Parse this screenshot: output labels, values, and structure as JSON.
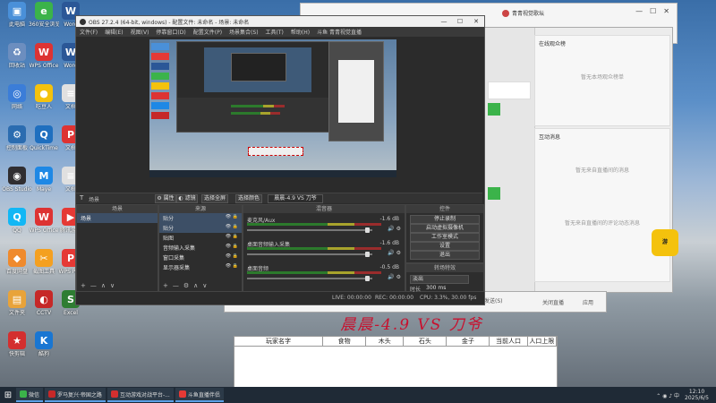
{
  "desktop": {
    "icons": [
      {
        "label": "此电脑",
        "color": "#4a90d9",
        "glyph": "▣"
      },
      {
        "label": "360安全浏览器",
        "color": "#3bb34a",
        "glyph": "e"
      },
      {
        "label": "Word",
        "color": "#2b5797",
        "glyph": "W"
      },
      {
        "label": "回收站",
        "color": "#6c8ebf",
        "glyph": "♻"
      },
      {
        "label": "WPS Office",
        "color": "#d33",
        "glyph": "W"
      },
      {
        "label": "Word",
        "color": "#2b5797",
        "glyph": "W"
      },
      {
        "label": "网络",
        "color": "#3b7dd8",
        "glyph": "◎"
      },
      {
        "label": "吃豆人",
        "color": "#f4c20d",
        "glyph": "●"
      },
      {
        "label": "文档",
        "color": "#e0e0e0",
        "glyph": "≡"
      },
      {
        "label": "控制面板",
        "color": "#2b6cb0",
        "glyph": "⚙"
      },
      {
        "label": "QuickTime",
        "color": "#1f6fbf",
        "glyph": "Q"
      },
      {
        "label": "文档",
        "color": "#d33",
        "glyph": "P"
      },
      {
        "label": "OBS Studio",
        "color": "#302e31",
        "glyph": "◉"
      },
      {
        "label": "Maye",
        "color": "#1e88e5",
        "glyph": "M"
      },
      {
        "label": "文档",
        "color": "#e0e0e0",
        "glyph": "≡"
      },
      {
        "label": "QQ",
        "color": "#12b7f5",
        "glyph": "Q"
      },
      {
        "label": "WPS Office",
        "color": "#d33",
        "glyph": "W"
      },
      {
        "label": "腾讯游戏",
        "color": "#e53935",
        "glyph": "▶"
      },
      {
        "label": "百度网盘",
        "color": "#ef8a2d",
        "glyph": "◆"
      },
      {
        "label": "截图工具",
        "color": "#f4a020",
        "glyph": "✂"
      },
      {
        "label": "WPS PDF",
        "color": "#e53935",
        "glyph": "P"
      },
      {
        "label": "文件夹",
        "color": "#e8a33a",
        "glyph": "▤"
      },
      {
        "label": "CCTV",
        "color": "#c62828",
        "glyph": "◐"
      },
      {
        "label": "Excel",
        "color": "#2e7d32",
        "glyph": "S"
      },
      {
        "label": "快剪辑",
        "color": "#d32f2f",
        "glyph": "★"
      },
      {
        "label": "酷狗",
        "color": "#1976d2",
        "glyph": "K"
      }
    ]
  },
  "obs": {
    "title": "OBS 27.2.4 (64-bit, windows) - 配置文件: 未命名 - 场景: 未命名",
    "menu": [
      "文件(F)",
      "编辑(E)",
      "视图(V)",
      "停靠窗口(D)",
      "配置文件(P)",
      "场景集合(S)",
      "工具(T)",
      "帮助(H)",
      "斗鱼 青青视觉直播"
    ],
    "toolbar": {
      "scene_label": "场景",
      "properties": "属性",
      "filters": "滤镜",
      "select_scene": "选择全屏",
      "select_color": "选择颜色",
      "status": "晨晨-4.9 VS 刀爷"
    },
    "docks": {
      "scenes": {
        "title": "场景",
        "items": [
          "场景"
        ]
      },
      "sources": {
        "title": "来源",
        "items": [
          "贴分",
          "贴分",
          "贴图",
          "音频输入采集",
          "窗口采集",
          "显示器采集"
        ]
      },
      "mixer": {
        "title": "混音器",
        "tracks": [
          {
            "name": "麦克风/Aux",
            "db": "-1.6 dB"
          },
          {
            "name": "桌面音频输入采集",
            "db": "-1.6 dB"
          },
          {
            "name": "桌面音频",
            "db": "-0.5 dB"
          }
        ]
      },
      "transitions": {
        "title": "转场特效",
        "type": "淡出",
        "duration_label": "时长",
        "duration": "300 ms"
      },
      "controls": {
        "title": "控件",
        "buttons": [
          "停止录制",
          "启动虚拟摄像机",
          "工作室模式",
          "设置",
          "退出"
        ]
      }
    },
    "statusbar": {
      "live": "LIVE: 00:00:00",
      "rec": "REC: 00:00:00",
      "cpu": "CPU: 3.3%, 30.00 fps"
    }
  },
  "topapp": {
    "user": "青青视觉歌坛",
    "tabs": [
      "..."
    ]
  },
  "chat": {
    "panel1_title": "在线观众榜",
    "panel1_empty": "暂无本场观众榜单",
    "panel2_title": "互动消息",
    "panel2_empty": "暂无来自直播间的消息",
    "panel3_empty": "暂无来自直播间的评论动态消息",
    "send": "发送(S)",
    "close_live": "关闭直播",
    "apply": "应用"
  },
  "banner": "晨晨-4.9 VS 刀爷",
  "score_table": {
    "headers": [
      "玩家名字",
      "食物",
      "木头",
      "石头",
      "金子",
      "当前人口",
      "人口上限"
    ],
    "rows": []
  },
  "taskbar": {
    "items": [
      {
        "label": "微信",
        "color": "#3bb34a"
      },
      {
        "label": "罗马复兴·帝国之路",
        "color": "#c62828"
      },
      {
        "label": "互动游戏对战平台-...",
        "color": "#d32f2f"
      },
      {
        "label": "斗鱼直播伴侣",
        "color": "#e53935"
      }
    ],
    "time": "12:10",
    "date": "2025/6/5"
  }
}
